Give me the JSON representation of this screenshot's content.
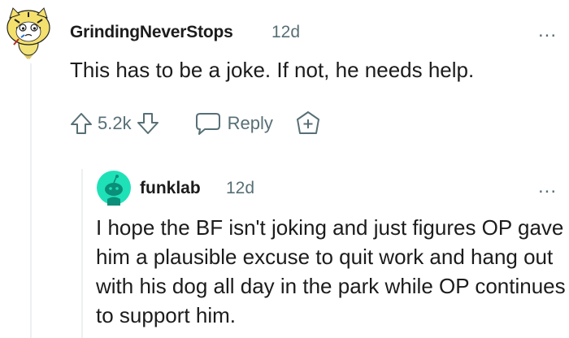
{
  "comment": {
    "username": "GrindingNeverStops",
    "time": "12d",
    "more": "...",
    "body": "This has to be a joke. If not, he needs help.",
    "score": "5.2k",
    "reply_label": "Reply"
  },
  "reply": {
    "username": "funklab",
    "time": "12d",
    "more": "...",
    "body": "I hope the BF isn't joking and just figures OP gave him a plausible excuse to quit work and hang out with his dog all day in the park while OP continues to support him."
  }
}
